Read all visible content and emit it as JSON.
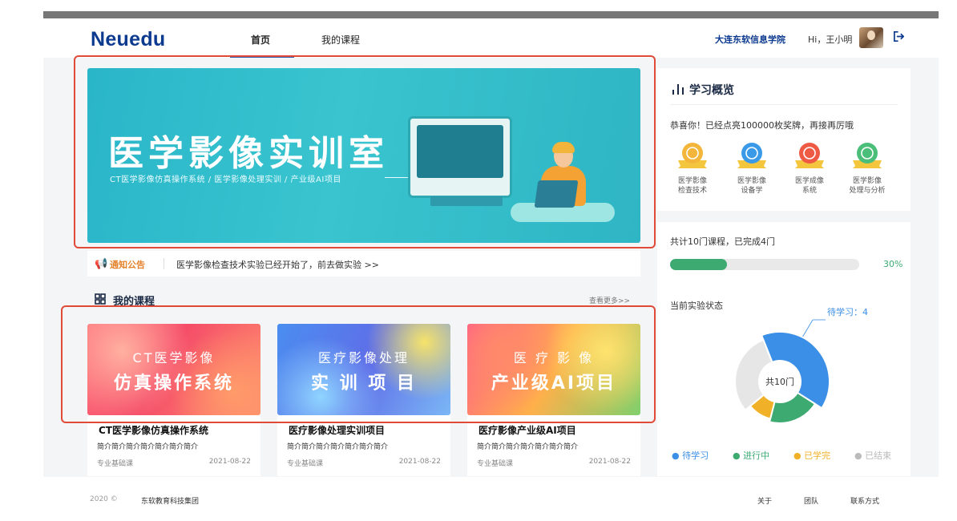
{
  "header": {
    "logo": "Neuedu",
    "nav": {
      "home": "首页",
      "my_courses": "我的课程"
    },
    "school": "大连东软信息学院",
    "greeting": "Hi，王小明"
  },
  "banner": {
    "title": "医学影像实训室",
    "subtitle": "CT医学影像仿真操作系统 / 医学影像处理实训 / 产业级AI项目"
  },
  "notice": {
    "label": "通知公告",
    "text": "医学影像检查技术实验已经开始了，前去做实验 >>"
  },
  "courses_section": {
    "title": "我的课程",
    "more": "查看更多>>",
    "items": [
      {
        "thumb_line1": "CT医学影像",
        "thumb_line2": "仿真操作系统",
        "title": "CT医学影像仿真操作系统",
        "desc": "简介简介简介简介简介简介简介",
        "type": "专业基础课",
        "date": "2021-08-22"
      },
      {
        "thumb_line1": "医疗影像处理",
        "thumb_line2": "实 训 项 目",
        "title": "医疗影像处理实训项目",
        "desc": "简介简介简介简介简介简介简介",
        "type": "专业基础课",
        "date": "2021-08-22"
      },
      {
        "thumb_line1": "医 疗 影 像",
        "thumb_line2": "产业级AI项目",
        "title": "医疗影像产业级AI项目",
        "desc": "简介简介简介简介简介简介简介",
        "type": "专业基础课",
        "date": "2021-08-22"
      }
    ]
  },
  "overview": {
    "title": "学习概览",
    "congrats": "恭喜你！已经点亮100000枚奖牌，再接再厉哦",
    "medals": [
      {
        "line1": "医学影像",
        "line2": "检查技术",
        "color": "#f3b53a"
      },
      {
        "line1": "医学影像",
        "line2": "设备学",
        "color": "#3b9ae8"
      },
      {
        "line1": "医学成像",
        "line2": "系统",
        "color": "#ef5a45"
      },
      {
        "line1": "医学影像",
        "line2": "处理与分析",
        "color": "#4bbf7a"
      }
    ]
  },
  "progress": {
    "text": "共计10门课程，已完成4门",
    "percent_label": "30%",
    "fraction": 0.3
  },
  "experiment": {
    "title": "当前实验状态",
    "center_label": "共10门",
    "callout": "待学习：4",
    "segments": [
      {
        "name": "待学习",
        "value": 4,
        "color": "#3b8fe6"
      },
      {
        "name": "进行中",
        "value": 2,
        "color": "#3daa72"
      },
      {
        "name": "已学完",
        "value": 1,
        "color": "#f0b128"
      },
      {
        "name": "已结束",
        "value": 3,
        "color": "#e6e6e6"
      }
    ],
    "legend": [
      "● 待学习",
      "● 进行中",
      "● 已学完",
      "● 已结束"
    ]
  },
  "footer": {
    "copyright": "2020 ©",
    "company": "东软教育科技集团",
    "links": [
      "关于",
      "团队",
      "联系方式"
    ]
  }
}
